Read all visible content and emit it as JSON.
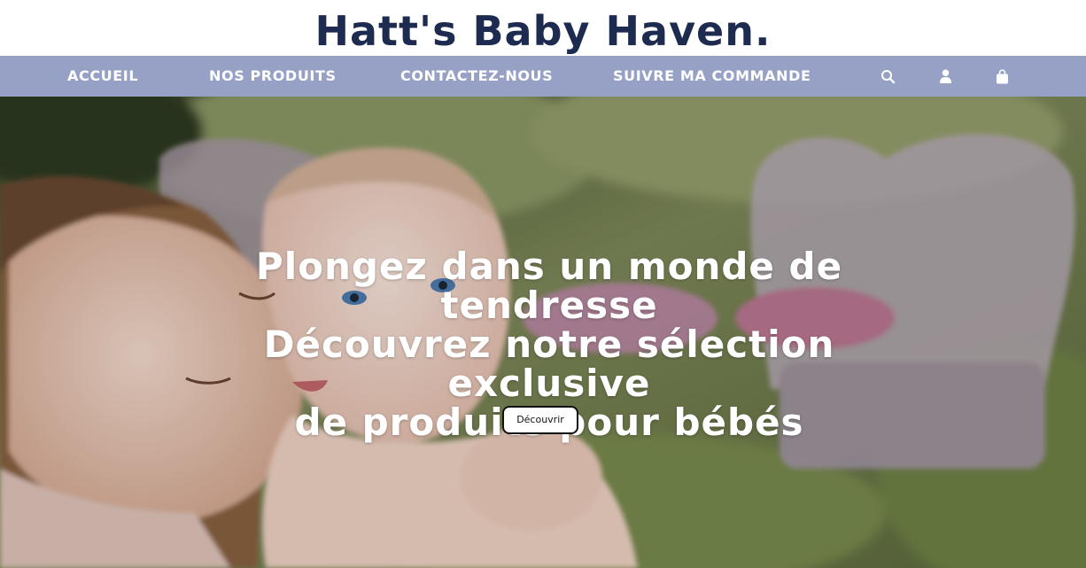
{
  "brand": {
    "title": "Hatt's Baby Haven."
  },
  "nav": {
    "items": [
      {
        "label": "ACCUEIL"
      },
      {
        "label": "NOS PRODUITS"
      },
      {
        "label": "CONTACTEZ-NOUS"
      },
      {
        "label": "SUIVRE MA COMMANDE"
      }
    ],
    "icons": [
      "search-icon",
      "user-icon",
      "shopping-bag-icon"
    ]
  },
  "hero": {
    "headline_lines": [
      "Plongez dans un monde de",
      "tendresse",
      "Découvrez notre sélection exclusive",
      "de produits pour bébés"
    ],
    "cta_label": "Découvrir"
  },
  "colors": {
    "brand_text": "#1c2b4f",
    "nav_background": "#96a1c5",
    "nav_text": "#ffffff",
    "hero_text": "#ffffff",
    "button_background": "#ffffff",
    "button_border": "#111111"
  }
}
